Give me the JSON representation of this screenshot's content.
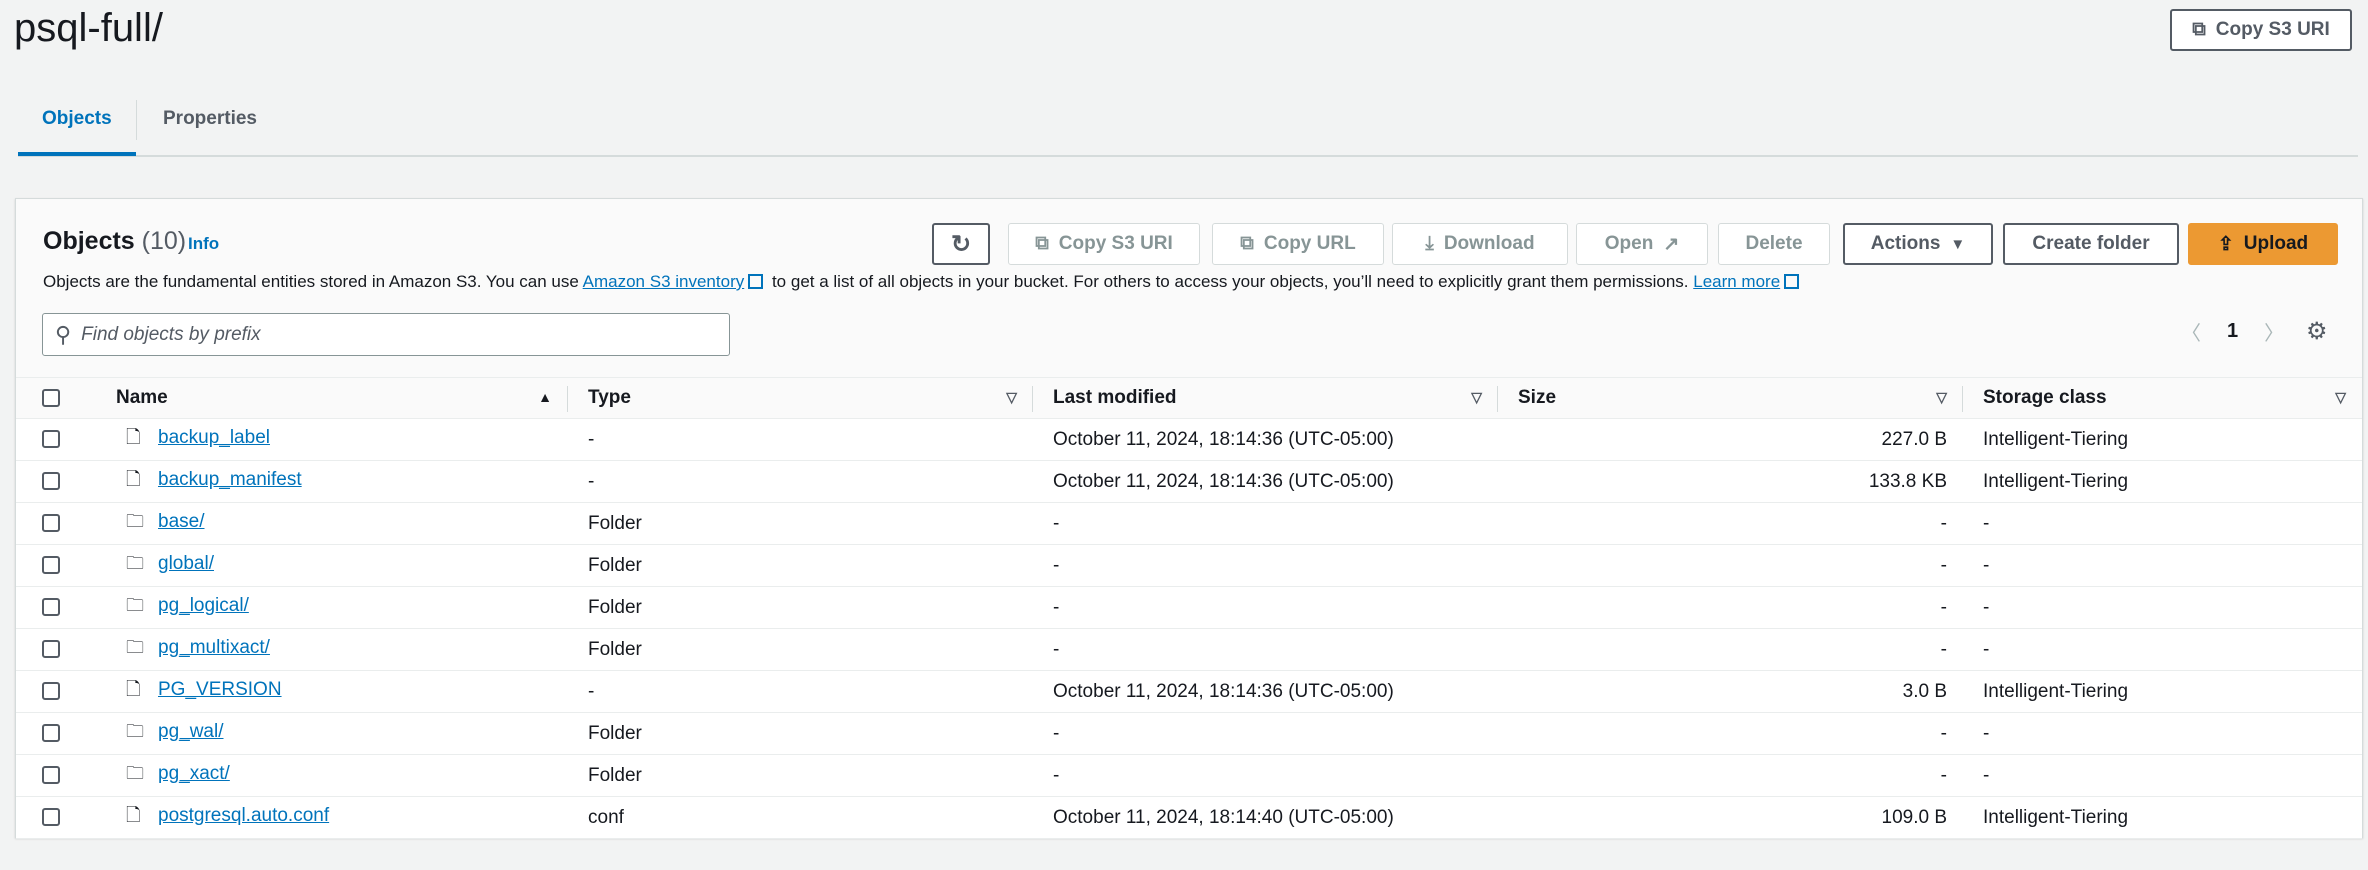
{
  "title": "psql-full/",
  "copy_s3_uri_top": "Copy S3 URI",
  "tabs": [
    {
      "label": "Objects",
      "active": true
    },
    {
      "label": "Properties",
      "active": false
    }
  ],
  "panel": {
    "heading": "Objects",
    "count": "(10)",
    "info": "Info",
    "desc_pre": "Objects are the fundamental entities stored in Amazon S3. You can use ",
    "desc_link": "Amazon S3 inventory",
    "desc_mid": " to get a list of all objects in your bucket. For others to access your objects, you’ll need to explicitly grant them permissions. ",
    "learn_more": "Learn more",
    "buttons": {
      "copy_s3_uri": "Copy S3 URI",
      "copy_url": "Copy URL",
      "download": "Download",
      "open": "Open",
      "delete": "Delete",
      "actions": "Actions",
      "create_folder": "Create folder",
      "upload": "Upload"
    },
    "search_placeholder": "Find objects by prefix",
    "page": "1",
    "accent": "#ec9932"
  },
  "columns": [
    "Name",
    "Type",
    "Last modified",
    "Size",
    "Storage class"
  ],
  "rows": [
    {
      "name": "backup_label",
      "icon": "file",
      "type": "-",
      "modified": "October 11, 2024, 18:14:36 (UTC-05:00)",
      "size": "227.0 B",
      "storage": "Intelligent-Tiering"
    },
    {
      "name": "backup_manifest",
      "icon": "file",
      "type": "-",
      "modified": "October 11, 2024, 18:14:36 (UTC-05:00)",
      "size": "133.8 KB",
      "storage": "Intelligent-Tiering"
    },
    {
      "name": "base/",
      "icon": "folder",
      "type": "Folder",
      "modified": "-",
      "size": "-",
      "storage": "-"
    },
    {
      "name": "global/",
      "icon": "folder",
      "type": "Folder",
      "modified": "-",
      "size": "-",
      "storage": "-"
    },
    {
      "name": "pg_logical/",
      "icon": "folder",
      "type": "Folder",
      "modified": "-",
      "size": "-",
      "storage": "-"
    },
    {
      "name": "pg_multixact/",
      "icon": "folder",
      "type": "Folder",
      "modified": "-",
      "size": "-",
      "storage": "-"
    },
    {
      "name": "PG_VERSION",
      "icon": "file",
      "type": "-",
      "modified": "October 11, 2024, 18:14:36 (UTC-05:00)",
      "size": "3.0 B",
      "storage": "Intelligent-Tiering"
    },
    {
      "name": "pg_wal/",
      "icon": "folder",
      "type": "Folder",
      "modified": "-",
      "size": "-",
      "storage": "-"
    },
    {
      "name": "pg_xact/",
      "icon": "folder",
      "type": "Folder",
      "modified": "-",
      "size": "-",
      "storage": "-"
    },
    {
      "name": "postgresql.auto.conf",
      "icon": "file",
      "type": "conf",
      "modified": "October 11, 2024, 18:14:40 (UTC-05:00)",
      "size": "109.0 B",
      "storage": "Intelligent-Tiering"
    }
  ]
}
